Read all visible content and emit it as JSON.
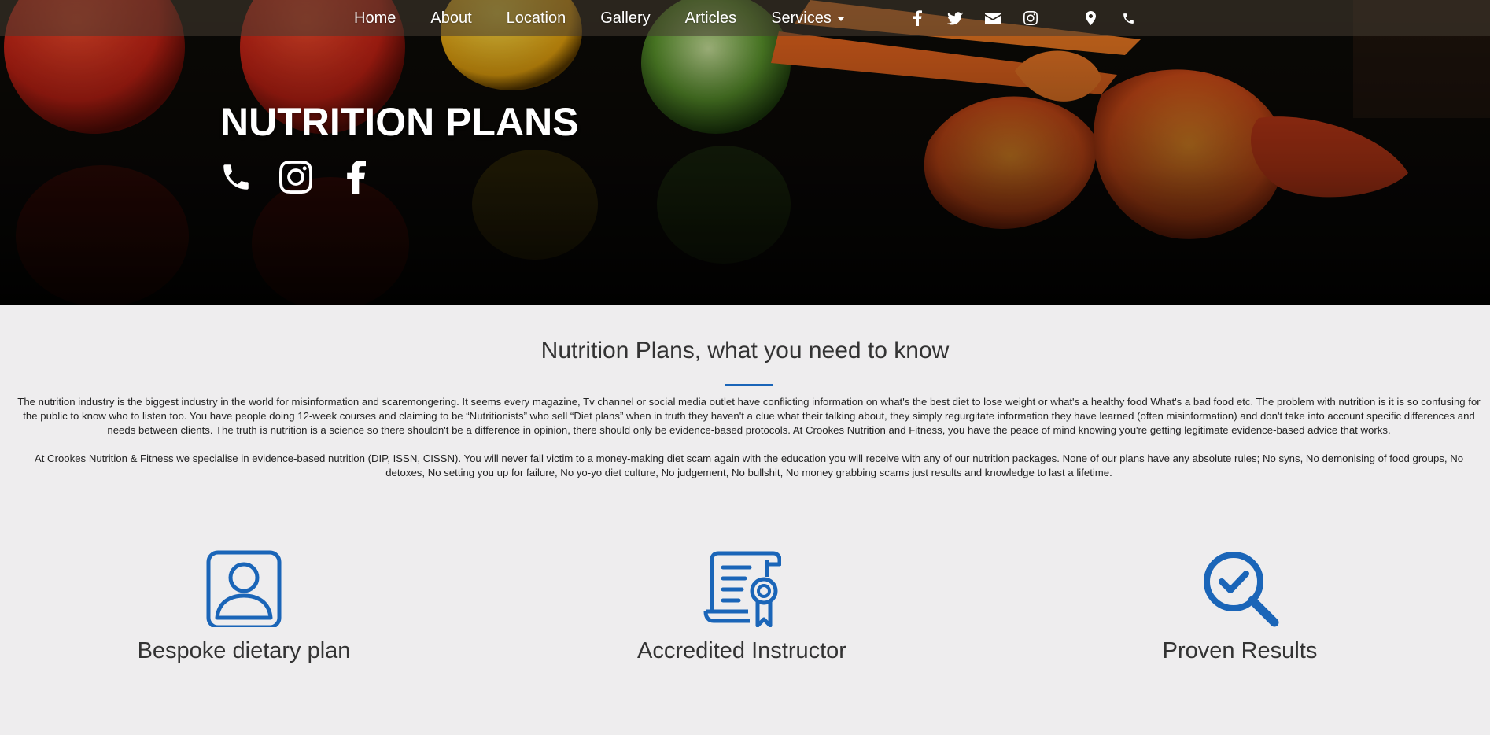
{
  "nav": {
    "links": [
      "Home",
      "About",
      "Location",
      "Gallery",
      "Articles",
      "Services"
    ],
    "social_icons": [
      "facebook-icon",
      "twitter-icon",
      "envelope-icon",
      "instagram-icon"
    ],
    "contact_icons": [
      "map-marker-icon",
      "phone-icon"
    ]
  },
  "hero": {
    "title": "NUTRITION PLANS",
    "icons": [
      "phone-icon",
      "instagram-icon",
      "facebook-icon"
    ]
  },
  "main": {
    "title": "Nutrition Plans, what you need to know",
    "paragraph1": "The nutrition industry is the biggest industry in the world for misinformation and scaremongering. It seems every magazine, Tv channel or social media outlet have conflicting information on what's the best diet to lose weight or what's a healthy food What's a bad food etc. The problem with nutrition is it is so confusing for the public to know who to listen too. You have people doing 12-week courses and claiming to be “Nutritionists” who sell “Diet plans” when in truth they haven't a clue what their talking about, they simply regurgitate information they have learned (often misinformation) and don't take into account specific differences and needs between clients. The truth is nutrition is a science so there shouldn't be a difference in opinion, there should only be evidence-based protocols. At Crookes Nutrition and Fitness, you have the peace of mind knowing you're getting legitimate evidence-based advice that works.",
    "paragraph2": "At Crookes Nutrition & Fitness we specialise in evidence-based nutrition (DIP, ISSN, CISSN). You will never fall victim to a money-making diet scam again with the education you will receive with any of our nutrition packages. None of our plans have any absolute rules; No syns, No demonising of food groups, No detoxes, No setting you up for failure, No yo-yo diet culture, No judgement, No bullshit, No money grabbing scams just results and knowledge to last a lifetime."
  },
  "features": [
    {
      "label": "Bespoke dietary plan",
      "icon": "user-profile-icon"
    },
    {
      "label": "Accredited Instructor",
      "icon": "certificate-icon"
    },
    {
      "label": "Proven Results",
      "icon": "magnifier-check-icon"
    }
  ],
  "colors": {
    "accent": "#1a65b8",
    "background": "#eeedee",
    "text": "#333333"
  }
}
